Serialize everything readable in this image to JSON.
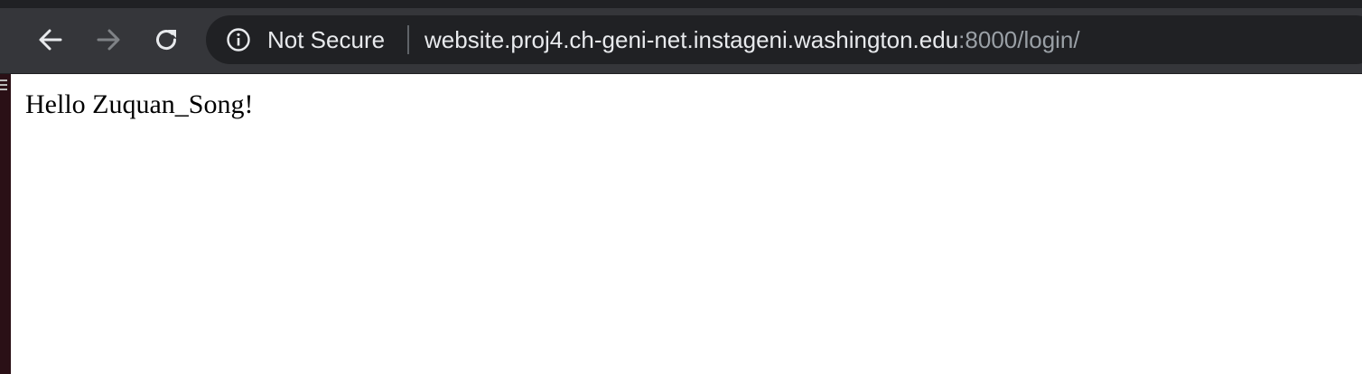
{
  "browser": {
    "nav": {
      "back_icon": "arrow-left-icon",
      "forward_icon": "arrow-right-icon",
      "reload_icon": "reload-icon"
    },
    "omnibox": {
      "security_icon": "info-icon",
      "security_label": "Not Secure",
      "url_host": "website.proj4.ch-geni-net.instageni.washington.edu",
      "url_rest": ":8000/login/"
    },
    "colors": {
      "toolbar_bg": "#35363a",
      "omnibox_bg": "#202124",
      "url_host": "#e8eaed",
      "url_rest": "#9aa0a6",
      "forward_disabled": "#7f8286"
    }
  },
  "page": {
    "greeting": "Hello Zuquan_Song!"
  }
}
